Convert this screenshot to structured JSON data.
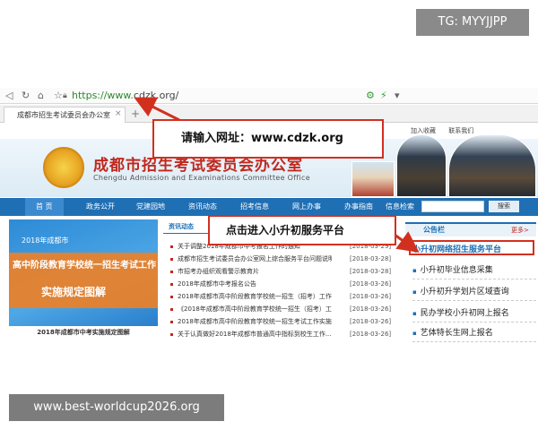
{
  "watermarks": {
    "top": "TG: MYYJJPP",
    "bottom": "www.best-worldcup2026.org"
  },
  "browser": {
    "url_scheme": "https://www.",
    "url_host": "cdzk.org/",
    "tab_title": "成都市招生考试委员会办公室",
    "icons": [
      "back-icon",
      "refresh-icon",
      "home-icon",
      "star-icon",
      "lock-icon",
      "extension-icon",
      "lightning-icon",
      "menu-icon"
    ]
  },
  "site": {
    "top_links": [
      "加入收藏",
      "联系我们"
    ],
    "title": "成都市招生考试委员会办公室",
    "subtitle": "Chengdu Admission and Examinations Committee Office",
    "nav": [
      "首  页",
      "政务公开",
      "党建园地",
      "资讯动态",
      "招考信息",
      "网上办事",
      "办事指南"
    ],
    "search_button": "搜索",
    "info_label": "信息检索"
  },
  "banner": {
    "year": "2018年成都市",
    "line1": "高中阶段教育学校统一招生考试工作",
    "line2": "实施规定图解",
    "footer": "2018年成都市中考实施规定图解"
  },
  "news": {
    "header": "资讯动态",
    "items": [
      {
        "title": "关于调整2018年成都市中考报名工作的通知",
        "date": "[2018-03-29]"
      },
      {
        "title": "成都市招生考试委员会办公室网上综合服务平台问题说明会...",
        "date": "[2018-03-28]"
      },
      {
        "title": "市招考办组织观看警示教育片",
        "date": "[2018-03-28]"
      },
      {
        "title": "2018年成都市中考报名公告",
        "date": "[2018-03-26]"
      },
      {
        "title": "2018年成都市高中阶段教育学校统一招生（招考）工作...",
        "date": "[2018-03-26]"
      },
      {
        "title": "《2018年成都市高中阶段教育学校统一招生（招考）工作...",
        "date": "[2018-03-26]"
      },
      {
        "title": "2018年成都市高中阶段教育学校统一招生考试工作实施...",
        "date": "[2018-03-26]"
      },
      {
        "title": "关于认真做好2018年成都市普通高中指标到校生工作...",
        "date": "[2018-03-26]"
      }
    ]
  },
  "panel": {
    "header": "公告栏",
    "more": "更多>",
    "title": "小升初网络招生服务平台",
    "items": [
      "小升初毕业信息采集",
      "小升初升学划片区域查询",
      "民办学校小升初网上报名",
      "艺体特长生网上报名"
    ]
  },
  "callouts": {
    "url_hint": "请输入网址：www.cdzk.org",
    "platform_hint": "点击进入小升初服务平台"
  },
  "colors": {
    "accent_red": "#d2301f",
    "nav_blue": "#1f6fb4",
    "title_red": "#c0281e"
  }
}
